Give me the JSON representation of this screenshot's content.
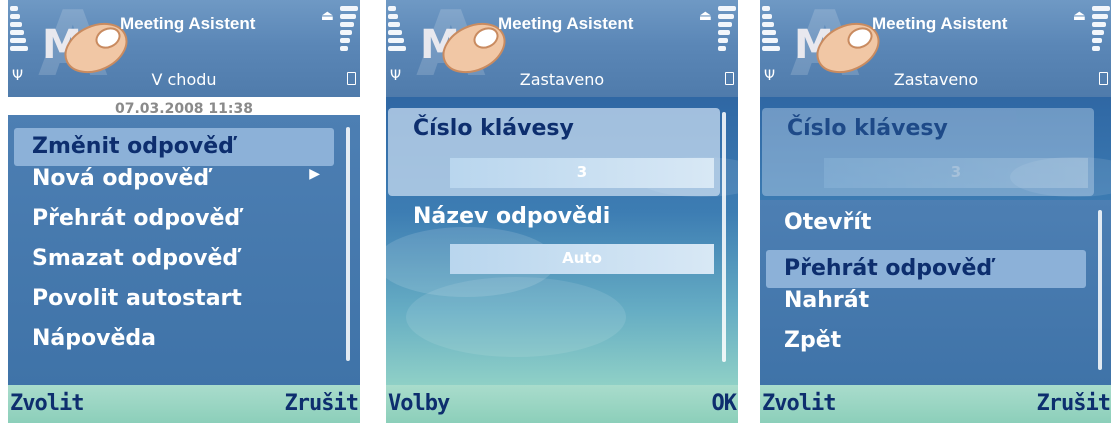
{
  "app_title": "Meeting Asistent",
  "screen1": {
    "status_text": "V chodu",
    "date_time": "07.03.2008 11:38",
    "menu_items": [
      {
        "label": "Změnit odpověď",
        "selected": true,
        "submenu": false
      },
      {
        "label": "Nová odpověď",
        "selected": false,
        "submenu": true
      },
      {
        "label": "Přehrát odpověď",
        "selected": false,
        "submenu": false
      },
      {
        "label": "Smazat odpověď",
        "selected": false,
        "submenu": false
      },
      {
        "label": "Povolit autostart",
        "selected": false,
        "submenu": false
      },
      {
        "label": "Nápověda",
        "selected": false,
        "submenu": false
      }
    ],
    "softkey_left": "Zvolit",
    "softkey_right": "Zrušit"
  },
  "screen2": {
    "status_text": "Zastaveno",
    "settings": [
      {
        "label": "Číslo klávesy",
        "value": "3",
        "selected": true
      },
      {
        "label": "Název odpovědi",
        "value": "Auto",
        "selected": false
      }
    ],
    "softkey_left": "Volby",
    "softkey_right": "OK"
  },
  "screen3": {
    "status_text": "Zastaveno",
    "settings": [
      {
        "label": "Číslo klávesy",
        "value": "3",
        "selected": true
      }
    ],
    "menu_items": [
      {
        "label": "Otevřít",
        "selected": false
      },
      {
        "label": "Přehrát odpověď",
        "selected": true
      },
      {
        "label": "Nahrát",
        "selected": false
      },
      {
        "label": "Zpět",
        "selected": false
      }
    ],
    "softkey_left": "Zvolit",
    "softkey_right": "Zrušit"
  },
  "icons": {
    "signal": "signal-strength-icon",
    "battery": "battery-level-icon",
    "antenna": "antenna-icon",
    "upload": "upload-arrow-icon",
    "logo": "phone-app-logo-icon"
  },
  "colors": {
    "status_bar": "#5b87b7",
    "menu_bg": "#4479ad",
    "selection": "#8cb1d8",
    "softkey_bg": "#8ccfba",
    "softkey_text": "#0d2e6e"
  }
}
